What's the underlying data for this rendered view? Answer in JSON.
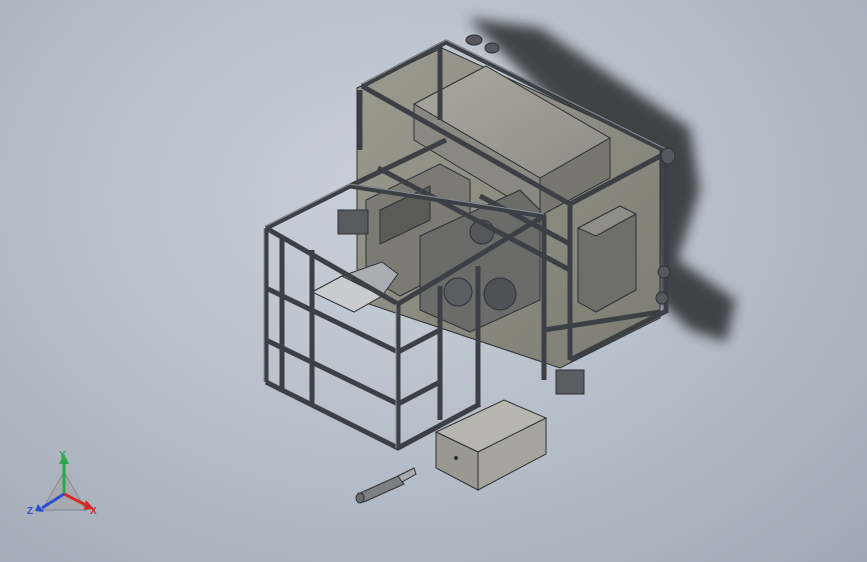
{
  "viewport": {
    "background_top": "#c9d0d9",
    "background_bottom": "#9fa8b4"
  },
  "model": {
    "frame_color": "#3c4046",
    "plate_color": "#8f8e82",
    "box_color": "#8b8b86",
    "shadow_color": "#2a2d33"
  },
  "triad": {
    "x_label": "X",
    "y_label": "Y",
    "z_label": "Z",
    "x_color": "#d42a2a",
    "y_color": "#2ca84a",
    "z_color": "#2b4fd4"
  }
}
